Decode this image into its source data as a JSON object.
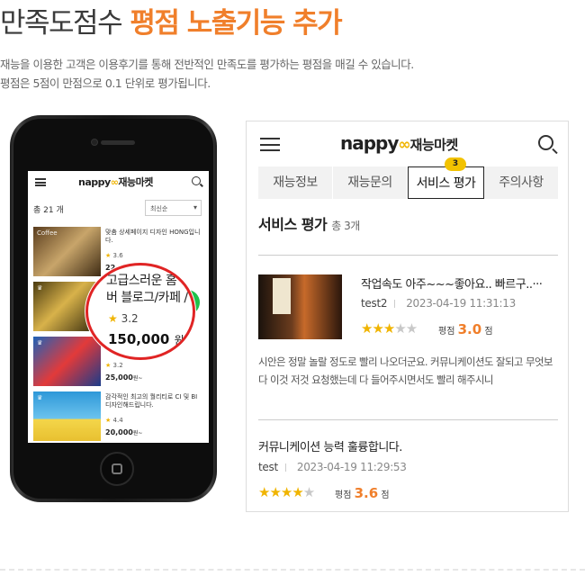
{
  "headline": {
    "part1": "만족도점수",
    "part2": "평점 노출기능 추가"
  },
  "description": [
    "재능을 이용한 고객은 이용후기를 통해 전반적인 만족도를 평가하는 평점을 매길 수 있습니다.",
    "평점은 5점이 만점으로 0.1 단위로 평가됩니다."
  ],
  "colors": {
    "accent": "#f07f2b",
    "star": "#f0b400",
    "highlight_circle": "#e02424",
    "chat": "#1fc24a"
  },
  "phone": {
    "logo": "nappy",
    "logo_mark": "∞",
    "logo_text": "재능마켓",
    "icons": [
      "menu-icon",
      "search-icon",
      "chat-icon",
      "home-button-icon"
    ],
    "total_count": "총 21 개",
    "sort_selected": "최신순",
    "items": [
      {
        "thumb_label": "Coffee",
        "title": "맞춤 상세페이지 디자인 HONG입니다.",
        "rating": "3.6",
        "price": "22",
        "price_unit": ""
      },
      {
        "thumb_label": "♛",
        "title": "",
        "rating": "",
        "price": "",
        "price_unit": ""
      },
      {
        "thumb_label": "♛",
        "title": "",
        "rating": "3.2",
        "price": "25,000",
        "price_unit": "원~"
      },
      {
        "thumb_label": "♛",
        "title": "감각적인 최고의 퀄리티로 CI 및 BI 디자인해드립니다.",
        "rating": "4.4",
        "price": "20,000",
        "price_unit": "원~"
      }
    ],
    "zoom": {
      "title_line1": "고급스러운 홈",
      "title_line2": "버 블로그/카페 /",
      "rating": "3.2",
      "price": "150,000",
      "price_unit": "원 ~"
    }
  },
  "panel": {
    "logo": "nappy",
    "logo_mark": "∞",
    "logo_text": "재능마켓",
    "tabs": [
      {
        "label": "재능정보"
      },
      {
        "label": "재능문의"
      },
      {
        "label": "서비스 평가"
      },
      {
        "label": "주의사항"
      }
    ],
    "active_tab_badge": "3",
    "section_title": "서비스 평가",
    "section_count": "총 3개",
    "reviews": [
      {
        "title": "작업속도 아주~~~좋아요.. 빠르구..···",
        "user": "test2",
        "date": "2023-04-19 11:31:13",
        "rating": 3.0,
        "score_label": "평점",
        "score": "3.0",
        "score_unit": "점",
        "body": "시안은 정말 놀랄 정도로 빨리 나오더군요. 커뮤니케이션도 잘되고 무엇보다 이것 저것 요청했는데 다 들어주시면서도 빨리 해주시니"
      },
      {
        "title": "커뮤니케이션 능력 훌륭합니다.",
        "user": "test",
        "date": "2023-04-19 11:29:53",
        "rating": 3.6,
        "score_label": "평점",
        "score": "3.6",
        "score_unit": "점"
      }
    ]
  }
}
